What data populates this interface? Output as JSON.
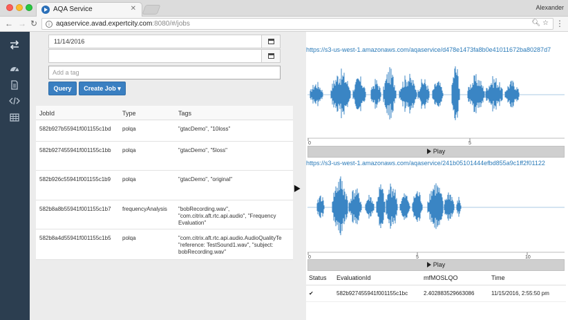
{
  "browser": {
    "tab_title": "AQA Service",
    "user": "Alexander",
    "url_host": "aqaservice.avad.expertcity.com",
    "url_rest": ":8080/#/jobs"
  },
  "sidebar": {
    "icons": [
      "exchange-icon",
      "dashboard-icon",
      "document-icon",
      "code-icon",
      "table-icon"
    ]
  },
  "filters": {
    "date_from": "11/14/2016",
    "date_to": "",
    "tag_placeholder": "Add a tag",
    "query_label": "Query",
    "create_job_label": "Create Job ▾"
  },
  "jobs": {
    "headers": [
      "JobId",
      "Type",
      "Tags"
    ],
    "rows": [
      {
        "id": "582b927b55941f001155c1bd",
        "type": "polqa",
        "tags": "\"gtacDemo\", \"10loss\""
      },
      {
        "id": "582b927455941f001155c1bb",
        "type": "polqa",
        "tags": "\"gtacDemo\", \"5loss\""
      },
      {
        "id": "582b926c55941f001155c1b9",
        "type": "polqa",
        "tags": "\"gtacDemo\", \"original\""
      },
      {
        "id": "582b8a8b55941f001155c1b7",
        "type": "frequencyAnalysis",
        "tags": "\"bobRecording.wav\",\n\"com.citrix.aft.rtc.api.audio\", \"Frequency\nEvaluation\""
      },
      {
        "id": "582b8a4d55941f001155c1b5",
        "type": "polqa",
        "tags": "\"com.citrix.aft.rtc.api.audio.AudioQualityTe\n\"reference: TestSound1.wav\", \"subject:\nbobRecording.wav\""
      }
    ]
  },
  "audio": [
    {
      "url": "https://s3-us-west-1.amazonaws.com/aqaservice/d478e1473fa8b0e41011672ba80287d7",
      "ticks": [
        "0",
        "5"
      ],
      "play_label": "Play"
    },
    {
      "url": "https://s3-us-west-1.amazonaws.com/aqaservice/241b05101444efbd855a9c1ff2f01122",
      "ticks": [
        "0",
        "5",
        "10"
      ],
      "play_label": "Play"
    }
  ],
  "evaluations": {
    "headers": [
      "Status",
      "EvaluationId",
      "mfMOSLQO",
      "Time"
    ],
    "rows": [
      {
        "status": "✔",
        "id": "582b927455941f001155c1bc",
        "score": "2.402883529663086",
        "time": "11/15/2016, 2:55:50 pm"
      }
    ]
  },
  "colors": {
    "accent": "#3a7fc1",
    "waveform": "#3a85c4",
    "sidebar": "#2c3e50"
  }
}
